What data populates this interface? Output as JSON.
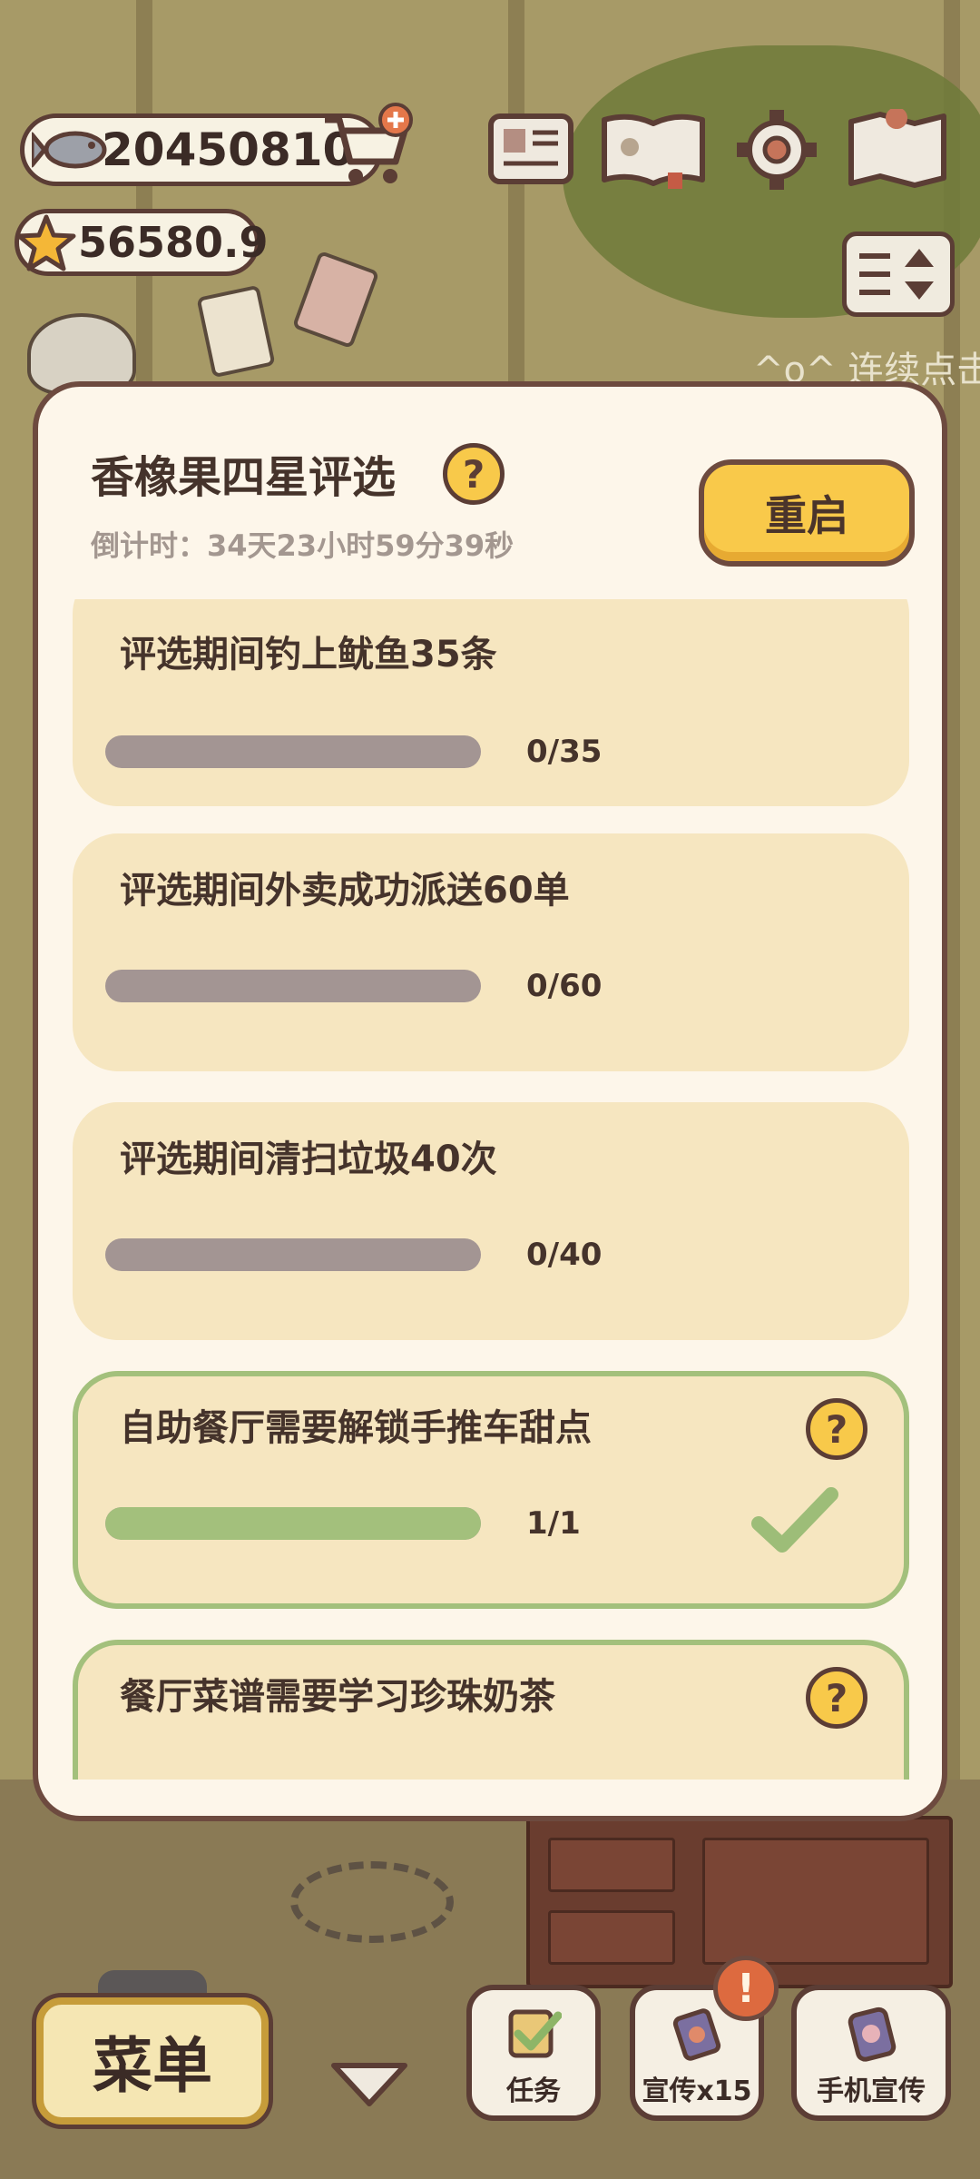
{
  "hud": {
    "coins": "20450810",
    "stars": "56580.9",
    "scene_hint": "^o^ 连续点击"
  },
  "panel": {
    "title": "香橡果四星评选",
    "countdown": "倒计时：34天23小时59分39秒",
    "restart_label": "重启",
    "help_glyph": "?",
    "tasks": [
      {
        "title": "评选期间钓上鱿鱼35条",
        "count": "0/35",
        "progress": 0.0,
        "completed": false
      },
      {
        "title": "评选期间外卖成功派送60单",
        "count": "0/60",
        "progress": 0.0,
        "completed": false
      },
      {
        "title": "评选期间清扫垃圾40次",
        "count": "0/40",
        "progress": 0.0,
        "completed": false
      },
      {
        "title": "自助餐厅需要解锁手推车甜点",
        "count": "1/1",
        "progress": 1.0,
        "completed": true
      },
      {
        "title": "餐厅菜谱需要学习珍珠奶茶",
        "count": "",
        "progress": 0.0,
        "completed": false
      }
    ]
  },
  "bottom_bar": {
    "menu_label": "菜单",
    "tasks_label": "任务",
    "promote_label": "宣传x15",
    "phone_promote_label": "手机宣传",
    "alert_glyph": "!"
  },
  "colors": {
    "panel_bg": "#fdf6ea",
    "card_bg": "#f6e6c0",
    "accent_yellow": "#f9c94a",
    "border_brown": "#6d4a3f",
    "progress_empty": "#a39593",
    "progress_done": "#a3c07c",
    "alert_orange": "#dd6a3f"
  },
  "icons": [
    "fish-coin-icon",
    "star-currency-icon",
    "shop-cart-icon",
    "newspaper-icon",
    "paw-book-icon",
    "gear-icon",
    "map-icon",
    "sort-toggle-icon",
    "help-icon",
    "checkmark-icon",
    "chevron-down-icon",
    "clipboard-check-icon",
    "promo-card-icon",
    "phone-promo-icon"
  ]
}
